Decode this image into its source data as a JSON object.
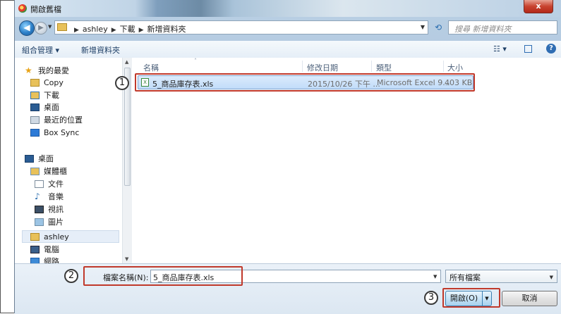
{
  "window": {
    "title": "開啟舊檔",
    "close": "x"
  },
  "nav": {
    "back": "◀",
    "forward": "▶",
    "breadcrumbs": [
      "ashley",
      "下載",
      "新增資料夾"
    ],
    "search_placeholder": "搜尋 新增資料夾"
  },
  "toolbar": {
    "organize": "組合管理 ▾",
    "new_folder": "新增資料夾",
    "view": "☷ ▾"
  },
  "sidebar": {
    "favorites": "我的最愛",
    "fav_items": [
      "Copy",
      "下載",
      "桌面",
      "最近的位置",
      "Box Sync"
    ],
    "desktop": "桌面",
    "libraries": "媒體櫃",
    "lib_items": [
      "文件",
      "音樂",
      "視訊",
      "圖片"
    ],
    "user": "ashley",
    "computer": "電腦",
    "network": "網路"
  },
  "columns": {
    "name": "名稱",
    "modified": "修改日期",
    "type": "類型",
    "size": "大小"
  },
  "files": [
    {
      "name": "5_商品庫存表.xls",
      "modified": "2015/10/26 下午 ...",
      "type": "Microsoft Excel 9...",
      "size": "403 KB"
    }
  ],
  "footer": {
    "filename_label": "檔案名稱(N):",
    "filename_value": "5_商品庫存表.xls",
    "filter": "所有檔案",
    "open_label": "開啟(O)",
    "cancel_label": "取消"
  },
  "callouts": [
    "1",
    "2",
    "3"
  ],
  "colors": {
    "callout": "#c0392b",
    "selection": "#c1dcf9",
    "accent": "#2f6db3"
  }
}
